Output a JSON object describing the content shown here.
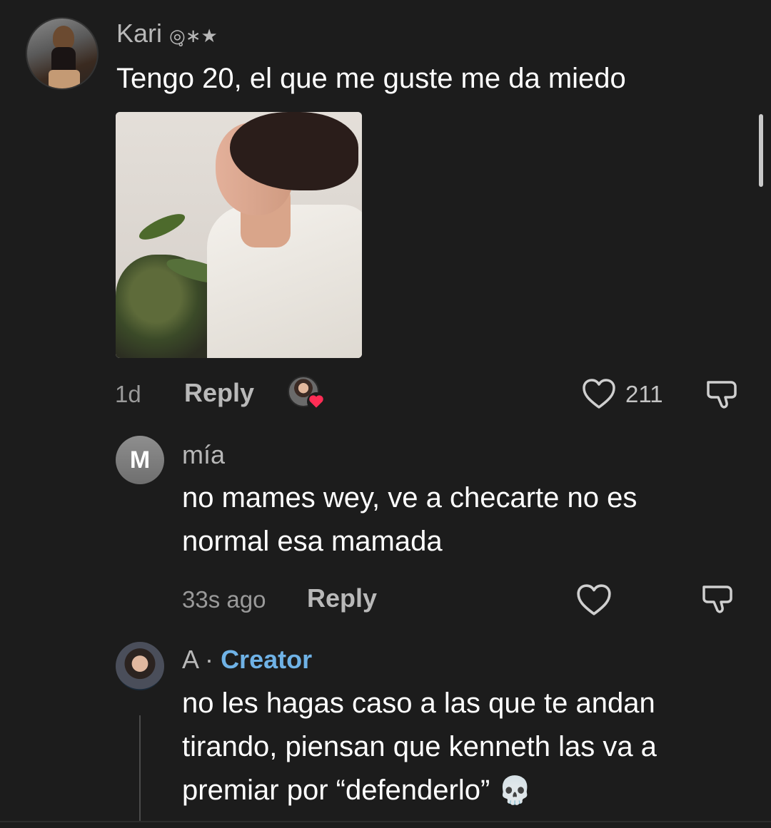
{
  "comments": [
    {
      "username": "Kari",
      "username_decoration": "◎̥∗★",
      "text": "Tengo 20, el que me guste me da miedo",
      "time": "1d",
      "reply_label": "Reply",
      "likes": "211"
    },
    {
      "avatar_letter": "M",
      "username": "mía",
      "text_line1": "no mames wey, ve a checarte no es",
      "text_line2": "normal esa mamada",
      "time": "33s ago",
      "reply_label": "Reply"
    },
    {
      "username": "A",
      "separator": "·",
      "badge": "Creator",
      "text_line1": "no les hagas caso a las que te andan",
      "text_line2": "tirando, piensan que kenneth las va a",
      "text_line3": "premiar por “defenderlo”",
      "emoji": "💀"
    }
  ],
  "colors": {
    "background": "#1c1c1c",
    "creator_badge": "#6fb2e6",
    "liked_heart": "#ff2d55"
  }
}
